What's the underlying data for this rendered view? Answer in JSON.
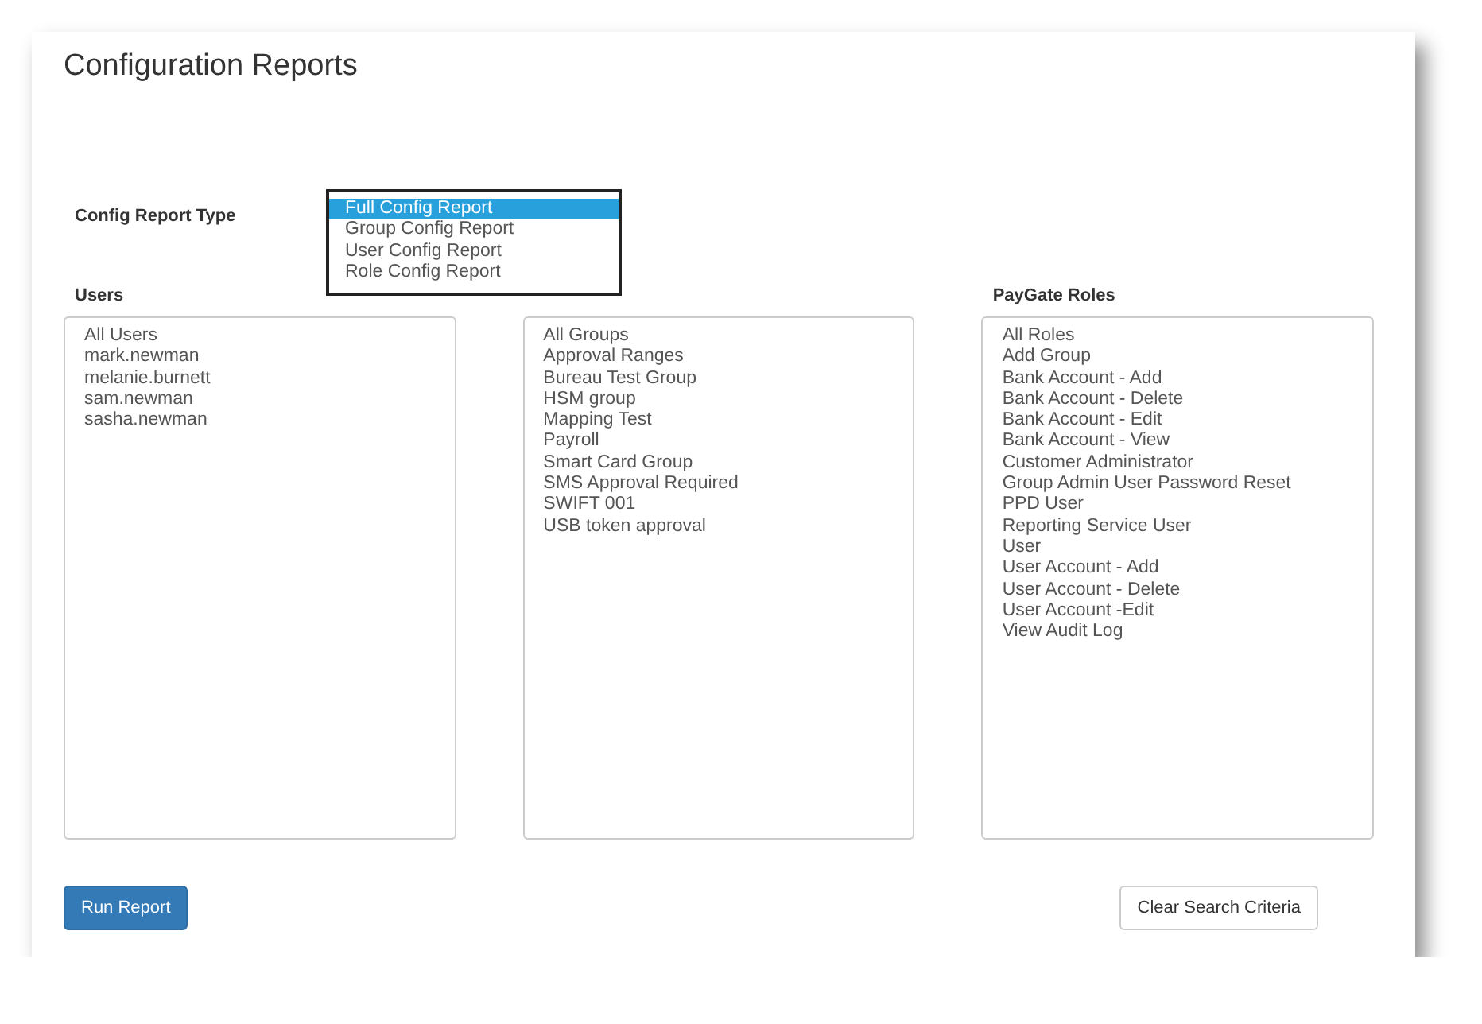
{
  "title": "Configuration Reports",
  "config_report_type": {
    "label": "Config Report Type",
    "options": [
      {
        "label": "Full Config Report",
        "selected": true
      },
      {
        "label": "Group Config Report",
        "selected": false
      },
      {
        "label": "User Config Report",
        "selected": false
      },
      {
        "label": "Role Config Report",
        "selected": false
      }
    ]
  },
  "lists": [
    {
      "label": "Users",
      "items": [
        "All Users",
        "mark.newman",
        "melanie.burnett",
        "sam.newman",
        "sasha.newman"
      ]
    },
    {
      "items": [
        "All Groups",
        "Approval Ranges",
        "Bureau Test Group",
        "HSM group",
        "Mapping Test",
        "Payroll",
        "Smart Card Group",
        "SMS Approval Required",
        "SWIFT 001",
        "USB token approval"
      ]
    },
    {
      "label": "PayGate Roles",
      "items": [
        "All Roles",
        "Add Group",
        "Bank Account - Add",
        "Bank Account - Delete",
        "Bank Account - Edit",
        "Bank Account - View",
        "Customer Administrator",
        "Group Admin User Password Reset",
        "PPD User",
        "Reporting Service User",
        "User",
        "User Account - Add",
        "User Account - Delete",
        "User Account -Edit",
        "View Audit Log"
      ]
    }
  ],
  "buttons": [
    {
      "kind": "primary",
      "label": "Run Report"
    },
    {
      "kind": "secondary",
      "label": "Clear Search Criteria"
    }
  ]
}
